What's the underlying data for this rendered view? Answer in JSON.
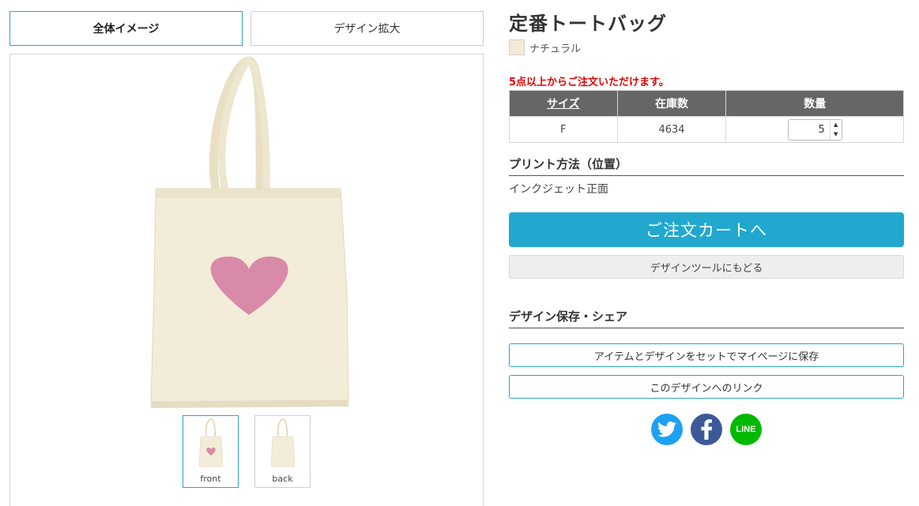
{
  "tabs": [
    {
      "label": "全体イメージ"
    },
    {
      "label": "デザイン拡大"
    }
  ],
  "thumbnails": [
    {
      "label": "front"
    },
    {
      "label": "back"
    }
  ],
  "product": {
    "title": "定番トートバッグ",
    "color_name": "ナチュラル",
    "color_swatch": "#f5ead8"
  },
  "notice": "5点以上からご注文いただけます。",
  "stock_table": {
    "headers": [
      "サイズ",
      "在庫数",
      "数量"
    ],
    "rows": [
      {
        "size": "F",
        "stock": "4634",
        "quantity": "5"
      }
    ]
  },
  "print": {
    "heading": "プリント方法（位置）",
    "method": "インクジェット正面"
  },
  "buttons": {
    "cart": "ご注文カートへ",
    "back_to_tool": "デザインツールにもどる",
    "save_mypage": "アイテムとデザインをセットでマイページに保存",
    "design_link": "このデザインへのリンク"
  },
  "share": {
    "heading": "デザイン保存・シェア",
    "line_label": "LINE"
  },
  "colors": {
    "accent": "#22a8cf",
    "notice": "#e60000",
    "table_header": "#666666",
    "heart": "#d98aa8",
    "bag": "#f3ecd9"
  }
}
